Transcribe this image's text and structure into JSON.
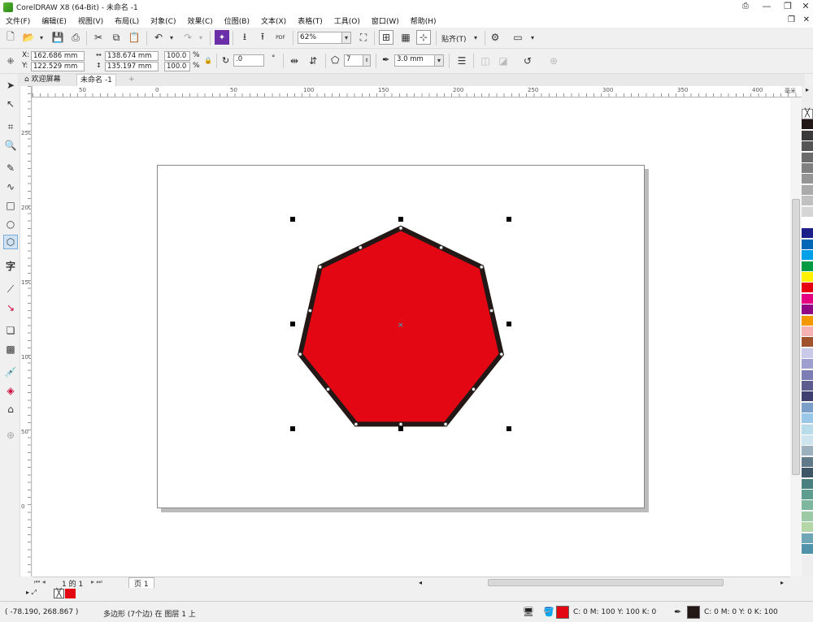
{
  "window": {
    "title": "CorelDRAW X8 (64-Bit) - 未命名 -1",
    "min": "—",
    "max": "❐",
    "close": "✕"
  },
  "menu": [
    "文件(F)",
    "编辑(E)",
    "视图(V)",
    "布局(L)",
    "对象(C)",
    "效果(C)",
    "位图(B)",
    "文本(X)",
    "表格(T)",
    "工具(O)",
    "窗口(W)",
    "帮助(H)"
  ],
  "toolbar": {
    "zoom": "62%",
    "snap_label": "贴齐(T)",
    "pdf_label": "PDF"
  },
  "property_bar": {
    "x_label": "X:",
    "x_value": "162.686 mm",
    "y_label": "Y:",
    "y_value": "122.529 mm",
    "width_value": "138.674 mm",
    "height_value": "135.197 mm",
    "scale_w": "100.0",
    "scale_h": "100.0",
    "pct": "%",
    "rotation": ".0",
    "degree": "°",
    "sides": "7",
    "outline_width": "3.0 mm"
  },
  "tabs": {
    "welcome": "欢迎屏幕",
    "document": "未命名 -1",
    "add": "+"
  },
  "ruler": {
    "unit": "毫米",
    "h_ticks": [
      "50",
      "0",
      "50",
      "100",
      "150",
      "200",
      "250",
      "300",
      "350",
      "400"
    ],
    "v_ticks": [
      "250",
      "200",
      "150",
      "100",
      "50",
      "0"
    ]
  },
  "polygon": {
    "sides": 7,
    "fill": "#e30613",
    "outline": "#231815"
  },
  "palette": [
    "#ffffff",
    "#231815",
    "#3a3a3a",
    "#555555",
    "#6b6b6b",
    "#808080",
    "#959595",
    "#aaaaaa",
    "#c0c0c0",
    "#d5d5d5",
    "#ffffff",
    "#1d2088",
    "#0068b7",
    "#00a0e9",
    "#009944",
    "#fff100",
    "#e60012",
    "#e4007f",
    "#920783",
    "#f39800",
    "#f5b2b2",
    "#a0522d",
    "#c9c9e8",
    "#9e9ecf",
    "#7d7db6",
    "#5c5c8e",
    "#404070",
    "#7b9fc9",
    "#9ac7e7",
    "#b7dbe9",
    "#cde3ee",
    "#9db0bd",
    "#607a8a",
    "#3f5666",
    "#4a7f7f",
    "#5f9e8f",
    "#7fb69e",
    "#9ccaa7",
    "#b5d7a8",
    "#6fa6b6",
    "#4f92aa"
  ],
  "page_nav": {
    "page_count": "1 的 1",
    "page_tab": "页 1"
  },
  "document_colors": {
    "fill_swatch": "#e30613"
  },
  "status": {
    "coords": "( -78.190, 268.867 )",
    "object_info": "多边形 (7个边) 在 图层 1 上",
    "fill_info": "C: 0 M: 100 Y: 100 K: 0",
    "outline_info": "C: 0 M: 0 Y: 0 K: 100",
    "fill_color": "#e30613",
    "outline_color": "#231815"
  }
}
